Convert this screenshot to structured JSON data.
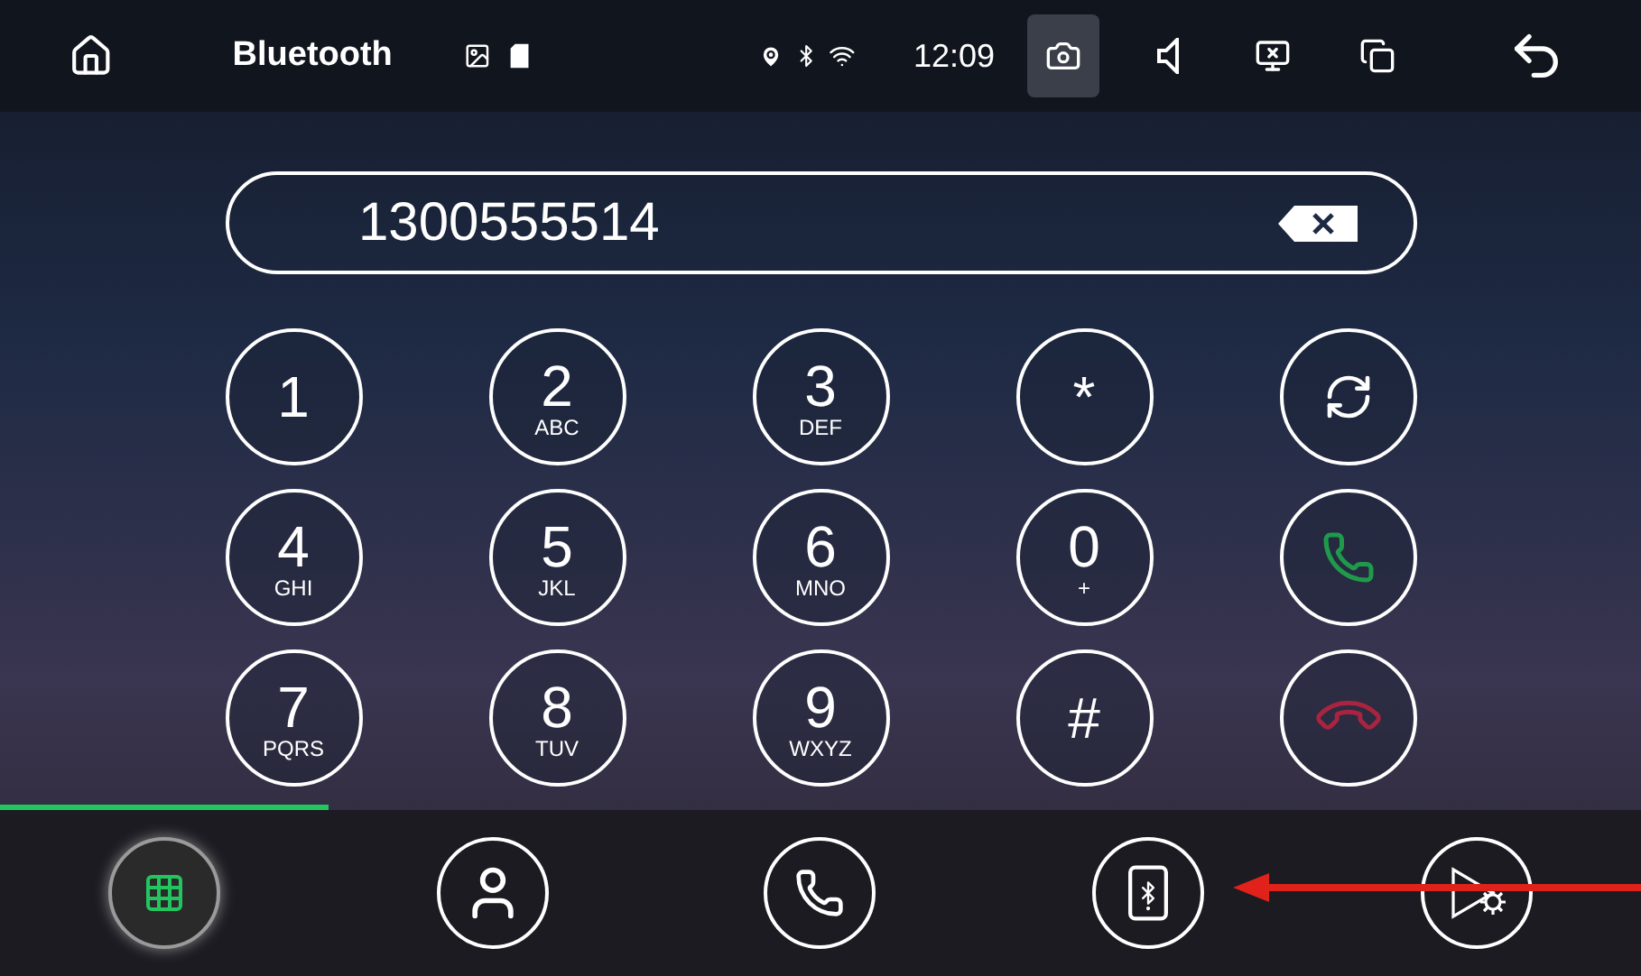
{
  "status_bar": {
    "title": "Bluetooth",
    "time": "12:09",
    "buttons": [
      {
        "kind": "camera",
        "selected": true
      },
      {
        "kind": "volume",
        "selected": false
      },
      {
        "kind": "screen",
        "selected": false
      },
      {
        "kind": "windows",
        "selected": false
      },
      {
        "kind": "back",
        "selected": false
      }
    ]
  },
  "number_field": {
    "value": "1300555514"
  },
  "keypad": [
    {
      "kind": "key",
      "label": "1"
    },
    {
      "kind": "key",
      "label": "2",
      "letters": "ABC"
    },
    {
      "kind": "key",
      "label": "3",
      "letters": "DEF"
    },
    {
      "kind": "key",
      "label": "*"
    },
    {
      "kind": "swap"
    },
    {
      "kind": "key",
      "label": "4",
      "letters": "GHI"
    },
    {
      "kind": "key",
      "label": "5",
      "letters": "JKL"
    },
    {
      "kind": "key",
      "label": "6",
      "letters": "MNO"
    },
    {
      "kind": "key",
      "label": "0",
      "letters": "+"
    },
    {
      "kind": "call"
    },
    {
      "kind": "key",
      "label": "7",
      "letters": "PQRS"
    },
    {
      "kind": "key",
      "label": "8",
      "letters": "TUV"
    },
    {
      "kind": "key",
      "label": "9",
      "letters": "WXYZ"
    },
    {
      "kind": "key",
      "label": "#"
    },
    {
      "kind": "hangup"
    }
  ],
  "tabs": [
    {
      "kind": "dialpad",
      "selected": true
    },
    {
      "kind": "contacts",
      "selected": false
    },
    {
      "kind": "calls",
      "selected": false
    },
    {
      "kind": "device",
      "selected": false
    },
    {
      "kind": "music",
      "selected": false
    }
  ]
}
